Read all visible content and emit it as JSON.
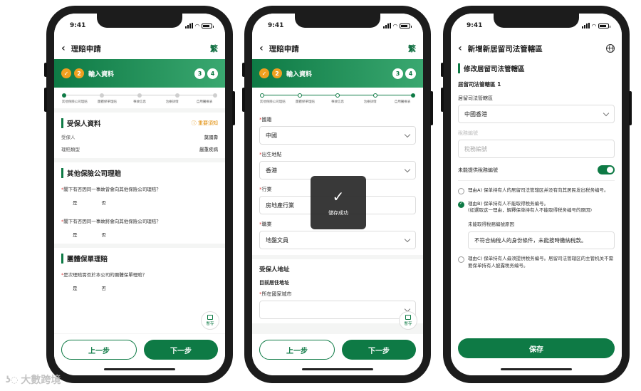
{
  "status": {
    "time": "9:41"
  },
  "phone1": {
    "nav_title": "理賠申請",
    "lang": "繁",
    "step": {
      "num": "2",
      "label": "輸入資料",
      "next1": "3",
      "next2": "4"
    },
    "progress_labels": [
      "其他保險公司理賠",
      "團體保單理賠",
      "事故信息",
      "治療詳情",
      "自用醫療表"
    ],
    "insured": {
      "title": "受保人資料",
      "notice": "重要須知",
      "rows": [
        {
          "k": "受保人",
          "v": "莫國壽"
        },
        {
          "k": "理賠類型",
          "v": "嚴重疾病"
        }
      ]
    },
    "other": {
      "title": "其他保險公司理賠",
      "q1": "閣下有否因同一事故曾會向其他保險公司理賠？",
      "q2": "閣下有否因同一事故將會向其他保險公司理賠？",
      "yes": "是",
      "no": "否"
    },
    "group": {
      "title": "團體保單理賠",
      "q1": "是次理賠需否於本公司的團體保單理賠？",
      "yes": "是",
      "no": "否"
    },
    "draft": "暫存",
    "prev": "上一步",
    "next": "下一步"
  },
  "phone2": {
    "nav_title": "理賠申請",
    "lang": "繁",
    "step": {
      "num": "2",
      "label": "輸入資料",
      "next1": "3",
      "next2": "4"
    },
    "progress_labels": [
      "其他保險公司理賠",
      "團體保單理賠",
      "事故信息",
      "治療詳情",
      "自用醫療表"
    ],
    "fields": [
      {
        "label": "國籍",
        "value": "中國"
      },
      {
        "label": "出生地點",
        "value": "香港"
      },
      {
        "label": "行業",
        "value": "房地產行業"
      },
      {
        "label": "職業",
        "value": "地盤文員"
      }
    ],
    "address_title": "受保人地址",
    "address_sub": "目前居住地址",
    "address_label": "所在國家城市",
    "toast": "儲存成功",
    "draft": "暫存",
    "prev": "上一步",
    "next": "下一步"
  },
  "phone3": {
    "nav_title": "新增新居留司法管轄區",
    "section_title": "修改居留司法管轄區",
    "jurisdiction_heading": "居留司法管轄區 1",
    "jurisdiction_label": "居留司法管轄區",
    "jurisdiction_value": "中國香港",
    "tax_label": "稅務編號",
    "tax_placeholder": "稅務編號",
    "no_tax_label": "未能提供稅務編號",
    "option_a": "理由A) 保单持有人的居留司法管辖区并没有向其居民发出税务编号。",
    "option_b": "理由B) 保单持有人不能取得税务编号。",
    "option_b_note": "(如選取这一理由，解釋保单持有人不能取得税务编号的原因)",
    "reason_label": "未能取得稅務編號原因",
    "reason_value": "不符合納稅人的身份條件，未能按時繳納稅款。",
    "option_c": "理由C) 保单持有人毋须提供税务编号。居留司法管辖区的主管机关不需要保单持有人披露税务编号。",
    "save": "保存"
  },
  "watermark": "大數跨境"
}
